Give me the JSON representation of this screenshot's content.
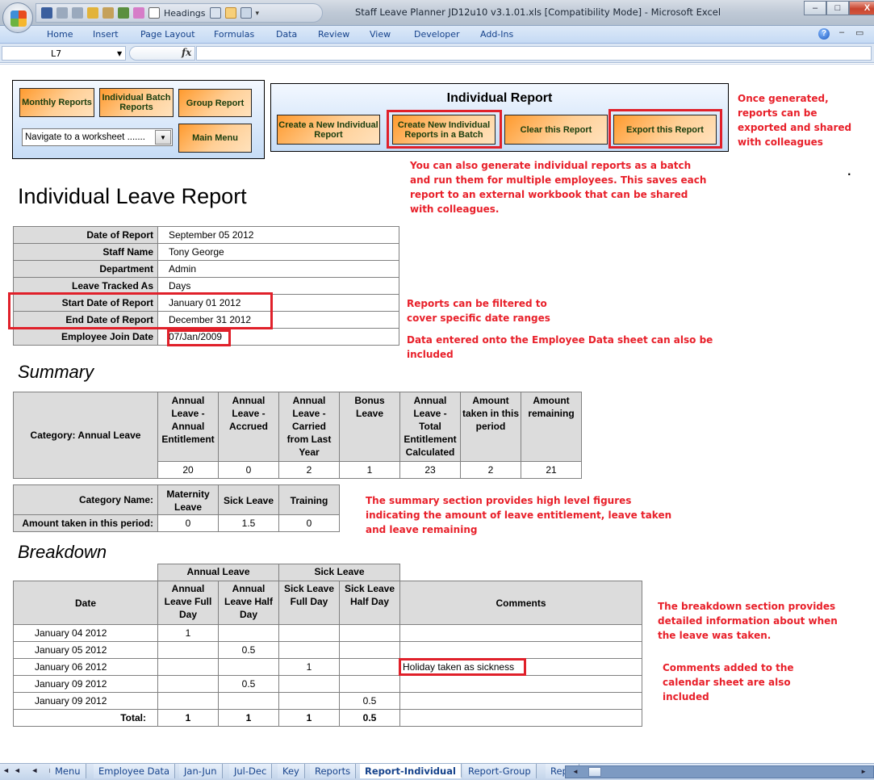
{
  "window": {
    "title": "Staff Leave Planner JD12u10 v3.1.01.xls  [Compatibility Mode] - Microsoft Excel",
    "qat_headings_label": "Headings",
    "minimize": "–",
    "maximize": "□",
    "close": "X"
  },
  "ribbon": {
    "tabs": [
      "Home",
      "Insert",
      "Page Layout",
      "Formulas",
      "Data",
      "Review",
      "View",
      "Developer",
      "Add-Ins"
    ],
    "help": "?",
    "minimize": "–",
    "restore": "▭"
  },
  "formula_bar": {
    "name_box": "L7",
    "fx": "fx",
    "formula": ""
  },
  "nav_panel": {
    "monthly_reports": "Monthly Reports",
    "individual_batch_reports": "Individual Batch Reports",
    "group_report": "Group Report",
    "main_menu": "Main Menu",
    "navigate_select": "Navigate to a worksheet ......."
  },
  "report_panel": {
    "title": "Individual Report",
    "create_new": "Create a New Individual Report",
    "create_batch": "Create New Individual Reports in a Batch",
    "clear": "Clear this Report",
    "export": "Export this Report"
  },
  "notes": {
    "export": "Once generated, reports can be exported and shared with colleagues",
    "batch": "You can also generate individual reports as a batch and run them for multiple employees. This saves each report to an external workbook that can be shared with colleagues.",
    "filter": "Reports can be filtered to cover specific date ranges",
    "employee_data": "Data entered onto the Employee Data sheet can also be included",
    "summary": "The summary section provides high level figures indicating the amount of leave entitlement, leave taken and leave remaining",
    "breakdown": "The breakdown section provides detailed information about when the leave was taken.",
    "comments": "Comments added to the calendar sheet are also included",
    "dot": "."
  },
  "report": {
    "title": "Individual Leave Report",
    "details": [
      {
        "label": "Date of Report",
        "value": "September 05 2012"
      },
      {
        "label": "Staff Name",
        "value": "Tony George"
      },
      {
        "label": "Department",
        "value": "Admin"
      },
      {
        "label": "Leave Tracked As",
        "value": "Days"
      },
      {
        "label": "Start Date of Report",
        "value": "January 01 2012"
      },
      {
        "label": "End Date of Report",
        "value": "December 31 2012"
      },
      {
        "label": "Employee Join Date",
        "value": "07/Jan/2009"
      }
    ]
  },
  "summary": {
    "title": "Summary",
    "category_label": "Category: Annual Leave",
    "headers": [
      "Annual Leave - Annual Entitlement",
      "Annual Leave - Accrued",
      "Annual Leave - Carried from Last Year",
      "Bonus Leave",
      "Annual Leave - Total Entitlement Calculated",
      "Amount taken in this period",
      "Amount remaining"
    ],
    "values": [
      "20",
      "0",
      "2",
      "1",
      "23",
      "2",
      "21"
    ],
    "other": {
      "category_name_label": "Category Name:",
      "amount_label": "Amount taken in this period:",
      "headers": [
        "Maternity Leave",
        "Sick Leave",
        "Training"
      ],
      "values": [
        "0",
        "1.5",
        "0"
      ]
    }
  },
  "breakdown": {
    "title": "Breakdown",
    "group_headers": [
      "Annual Leave",
      "Sick Leave"
    ],
    "date_header": "Date",
    "headers": [
      "Annual Leave Full Day",
      "Annual Leave Half Day",
      "Sick Leave Full Day",
      "Sick Leave Half Day"
    ],
    "comments_header": "Comments",
    "rows": [
      {
        "date": "January 04 2012",
        "al_full": "1",
        "al_half": "",
        "sl_full": "",
        "sl_half": "",
        "comment": ""
      },
      {
        "date": "January 05 2012",
        "al_full": "",
        "al_half": "0.5",
        "sl_full": "",
        "sl_half": "",
        "comment": ""
      },
      {
        "date": "January 06 2012",
        "al_full": "",
        "al_half": "",
        "sl_full": "1",
        "sl_half": "",
        "comment": "Holiday taken as sickness"
      },
      {
        "date": "January 09 2012",
        "al_full": "",
        "al_half": "0.5",
        "sl_full": "",
        "sl_half": "",
        "comment": ""
      },
      {
        "date": "January 09 2012",
        "al_full": "",
        "al_half": "",
        "sl_full": "",
        "sl_half": "0.5",
        "comment": ""
      }
    ],
    "total_label": "Total:",
    "totals": [
      "1",
      "1",
      "1",
      "0.5"
    ]
  },
  "sheet_tabs": {
    "tabs": [
      "Menu",
      "Employee Data",
      "Jan-Jun",
      "Jul-Dec",
      "Key",
      "Reports",
      "Report-Individual",
      "Report-Group",
      "Repo"
    ],
    "active": "Report-Individual",
    "nav": "◄◄ ◄ ► ►►"
  }
}
